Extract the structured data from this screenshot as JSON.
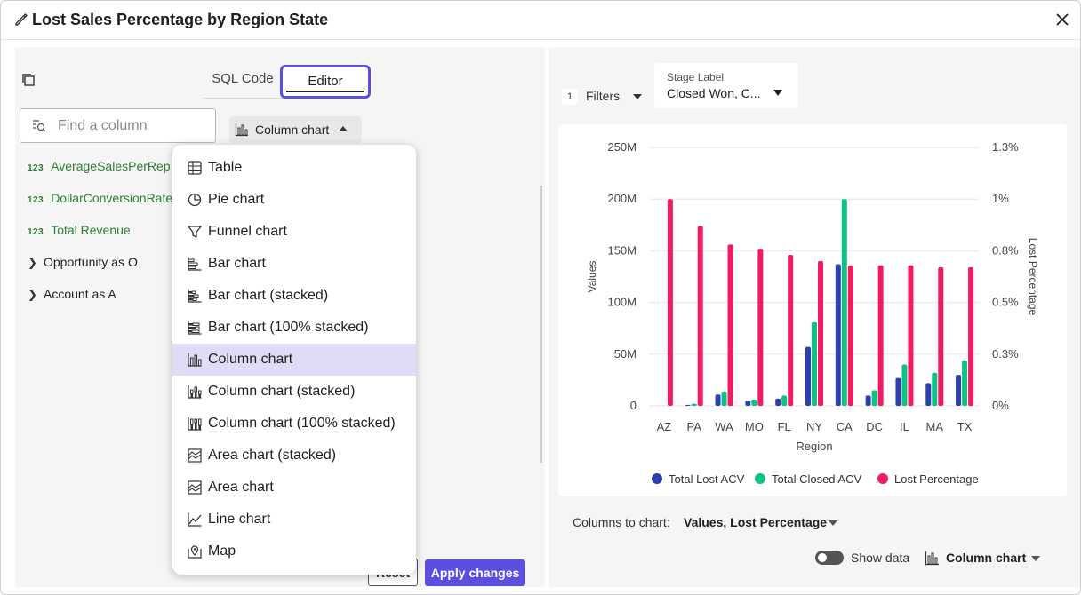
{
  "window": {
    "title": "Lost Sales Percentage by Region State"
  },
  "tabs": {
    "sql": "SQL Code",
    "editor": "Editor"
  },
  "search": {
    "placeholder": "Find a column"
  },
  "columns": [
    {
      "type": "123",
      "label": "AverageSalesPerRep"
    },
    {
      "type": "123",
      "label": "DollarConversionRate"
    },
    {
      "type": "123",
      "label": "Total Revenue"
    }
  ],
  "tree": [
    {
      "label": "Opportunity as O"
    },
    {
      "label": "Account as A"
    }
  ],
  "chart_type_select": {
    "label": "Column chart"
  },
  "dropdown": {
    "items": [
      {
        "label": "Table",
        "icon": "table-icon"
      },
      {
        "label": "Pie chart",
        "icon": "pie-chart-icon"
      },
      {
        "label": "Funnel chart",
        "icon": "funnel-icon"
      },
      {
        "label": "Bar chart",
        "icon": "bar-chart-icon"
      },
      {
        "label": "Bar chart (stacked)",
        "icon": "bar-stacked-icon"
      },
      {
        "label": "Bar chart (100% stacked)",
        "icon": "bar-100-stacked-icon"
      },
      {
        "label": "Column chart",
        "icon": "column-chart-icon",
        "selected": true
      },
      {
        "label": "Column chart (stacked)",
        "icon": "column-stacked-icon"
      },
      {
        "label": "Column chart (100% stacked)",
        "icon": "column-100-stacked-icon"
      },
      {
        "label": "Area chart (stacked)",
        "icon": "area-stacked-icon"
      },
      {
        "label": "Area chart",
        "icon": "area-chart-icon"
      },
      {
        "label": "Line chart",
        "icon": "line-chart-icon"
      },
      {
        "label": "Map",
        "icon": "map-icon"
      }
    ]
  },
  "buttons": {
    "reset": "Reset",
    "apply": "Apply changes"
  },
  "filters": {
    "count": "1",
    "label": "Filters"
  },
  "stage_filter": {
    "label": "Stage Label",
    "value": "Closed Won, C..."
  },
  "chart_data": {
    "type": "bar",
    "categories": [
      "AZ",
      "PA",
      "WA",
      "MO",
      "FL",
      "NY",
      "CA",
      "DC",
      "IL",
      "MA",
      "TX"
    ],
    "xlabel": "Region",
    "ylabel": "Values",
    "y2label": "Lost Percentage",
    "ylim": [
      0,
      250000000
    ],
    "y2lim": [
      0,
      1.25
    ],
    "yticks": [
      "0",
      "50M",
      "100M",
      "150M",
      "200M",
      "250M"
    ],
    "y2ticks": [
      "0%",
      "0.3%",
      "0.5%",
      "0.8%",
      "1%",
      "1.3%"
    ],
    "series": [
      {
        "name": "Total Lost ACV",
        "axis": "left",
        "color": "#2f3fae",
        "values": [
          0,
          1000000,
          11000000,
          5000000,
          7000000,
          57000000,
          137000000,
          10000000,
          27000000,
          22000000,
          30000000
        ]
      },
      {
        "name": "Total Closed ACV",
        "axis": "left",
        "color": "#0ec285",
        "values": [
          0,
          2000000,
          14000000,
          6000000,
          10000000,
          81000000,
          200000000,
          15000000,
          40000000,
          32000000,
          44000000
        ]
      },
      {
        "name": "Lost Percentage",
        "axis": "right",
        "color": "#f21a63",
        "values": [
          1.0,
          0.87,
          0.78,
          0.76,
          0.73,
          0.7,
          0.68,
          0.68,
          0.68,
          0.67,
          0.67
        ]
      }
    ],
    "grid": true,
    "legend": "bottom"
  },
  "columns_to_chart": {
    "label": "Columns to chart:",
    "value": "Values, Lost Percentage"
  },
  "show_data": {
    "label": "Show data"
  },
  "bottom_chart_type": {
    "label": "Column chart"
  }
}
